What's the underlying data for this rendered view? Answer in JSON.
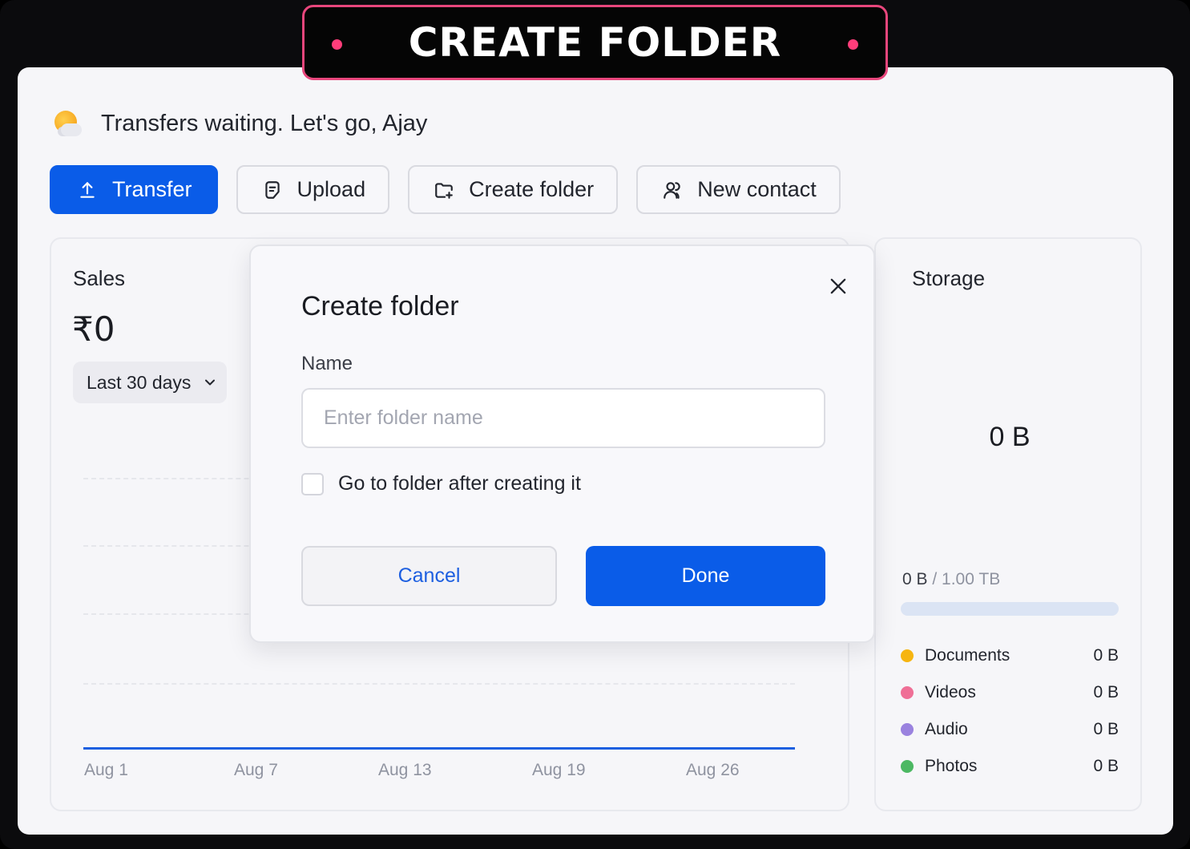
{
  "banner": {
    "title": "CREATE FOLDER"
  },
  "greeting": {
    "text": "Transfers waiting. Let's go, Ajay",
    "icon": "sun-cloud-icon"
  },
  "actions": [
    {
      "label": "Transfer",
      "icon": "upload-arrow-icon",
      "primary": true
    },
    {
      "label": "Upload",
      "icon": "document-icon"
    },
    {
      "label": "Create folder",
      "icon": "folder-plus-icon"
    },
    {
      "label": "New contact",
      "icon": "user-add-icon"
    }
  ],
  "sales": {
    "title": "Sales",
    "amount": "₹0",
    "range": "Last 30 days",
    "chart_data": {
      "type": "line",
      "x": [
        "Aug 1",
        "Aug 7",
        "Aug 13",
        "Aug 19",
        "Aug 26"
      ],
      "series": [
        {
          "values": [
            0,
            0,
            0,
            0,
            0
          ]
        }
      ],
      "grid": true,
      "color": "#1d5fe0"
    }
  },
  "storage": {
    "title": "Storage",
    "total": "0 B",
    "used": "0 B",
    "capacity": "/ 1.00 TB",
    "used_fraction": 0,
    "legend": [
      {
        "label": "Documents",
        "value": "0 B",
        "color": "#f6b511"
      },
      {
        "label": "Videos",
        "value": "0 B",
        "color": "#ef6f96"
      },
      {
        "label": "Audio",
        "value": "0 B",
        "color": "#9a82df"
      },
      {
        "label": "Photos",
        "value": "0 B",
        "color": "#4cb863"
      }
    ]
  },
  "dialog": {
    "title": "Create folder",
    "name_label": "Name",
    "name_placeholder": "Enter folder name",
    "name_value": "",
    "checkbox_label": "Go to folder after creating it",
    "checkbox_checked": false,
    "cancel_label": "Cancel",
    "done_label": "Done"
  }
}
